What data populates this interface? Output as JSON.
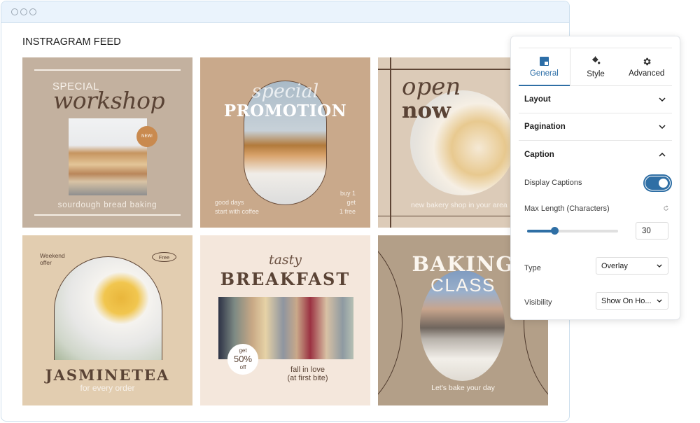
{
  "window": {
    "controls": [
      "dot",
      "dot",
      "dot"
    ]
  },
  "feed": {
    "title": "INSTRAGRAM FEED",
    "posts": [
      {
        "theme_color": "#c3b19f",
        "heading_small": "SPECIAL",
        "heading_script": "workshop",
        "badge": "NEW!",
        "caption": "sourdough bread baking"
      },
      {
        "theme_color": "#c9a98b",
        "heading_script": "special",
        "heading_big": "PROMOTION",
        "left_text": [
          "good days",
          "start with coffee"
        ],
        "right_text": [
          "buy 1",
          "get",
          "1 free"
        ]
      },
      {
        "theme_color": "#dccbb8",
        "heading_script": "open",
        "heading_big": "now",
        "caption": "new bakery shop in your area"
      },
      {
        "theme_color": "#e2cdb0",
        "tag_left": [
          "Weekend",
          "offer"
        ],
        "tag_right": "Free",
        "heading_big": "JASMINETEA",
        "caption": "for every order"
      },
      {
        "theme_color": "#f4e7dc",
        "heading_script": "tasty",
        "heading_big": "BREAKFAST",
        "badge": [
          "get",
          "50%",
          "off"
        ],
        "caption": [
          "fall in love",
          "(at first bite)"
        ]
      },
      {
        "theme_color": "#b39f88",
        "heading_big": "BAKING",
        "heading_thin": "CLASS",
        "caption": "Let's bake your day"
      }
    ]
  },
  "panel": {
    "tabs": [
      {
        "label": "General",
        "icon": "layout-icon",
        "active": true
      },
      {
        "label": "Style",
        "icon": "paint-bucket-icon",
        "active": false
      },
      {
        "label": "Advanced",
        "icon": "gear-icon",
        "active": false
      }
    ],
    "sections": [
      {
        "label": "Layout",
        "expanded": false
      },
      {
        "label": "Pagination",
        "expanded": false
      },
      {
        "label": "Caption",
        "expanded": true
      }
    ],
    "caption": {
      "display_captions_label": "Display Captions",
      "display_captions_on": true,
      "max_length_label": "Max Length (Characters)",
      "max_length_value": "30",
      "max_length_slider_fraction": 0.3,
      "type_label": "Type",
      "type_value": "Overlay",
      "visibility_label": "Visibility",
      "visibility_value": "Show On Ho..."
    },
    "accent_color": "#2f6fa5"
  }
}
